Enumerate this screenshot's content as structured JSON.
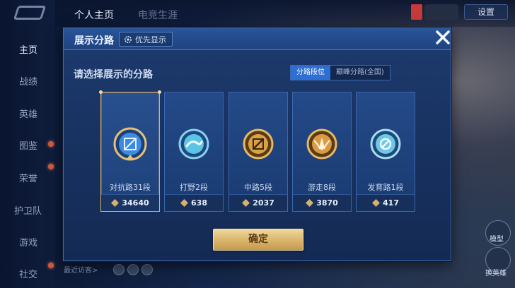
{
  "left_nav": [
    {
      "label": "主页",
      "active": true
    },
    {
      "label": "战绩",
      "active": false
    },
    {
      "label": "英雄",
      "active": false
    },
    {
      "label": "图鉴",
      "active": false
    },
    {
      "label": "荣誉",
      "active": false
    },
    {
      "label": "护卫队",
      "active": false
    },
    {
      "label": "游戏",
      "active": false
    },
    {
      "label": "社交",
      "active": false
    }
  ],
  "top_bar": {
    "tab_home": "个人主页",
    "tab_other": "电竞生涯",
    "settings": "设置"
  },
  "modal": {
    "title": "展示分路",
    "priority_label": "优先显示",
    "prompt": "请选择展示的分路",
    "seg_rank": "分路段位",
    "seg_peak": "巅峰分路(全国)",
    "confirm": "确定"
  },
  "cards": [
    {
      "label": "对抗路31段",
      "score": "34640",
      "color": "#3d8be0",
      "icon": "shield-sword-icon",
      "selected": true
    },
    {
      "label": "打野2段",
      "score": "638",
      "color": "#5cc4e6",
      "icon": "wave-icon",
      "selected": false
    },
    {
      "label": "中路5段",
      "score": "2037",
      "color": "#d9a24a",
      "icon": "slash-icon",
      "selected": false
    },
    {
      "label": "游走8段",
      "score": "3870",
      "color": "#d99a45",
      "icon": "wings-icon",
      "selected": false
    },
    {
      "label": "发育路1段",
      "score": "417",
      "color": "#6ec6e8",
      "icon": "ring-icon",
      "selected": false
    }
  ],
  "bottom": {
    "hint": "最近访客>"
  },
  "side": {
    "model": "模型",
    "swap_hero": "换英雄"
  }
}
